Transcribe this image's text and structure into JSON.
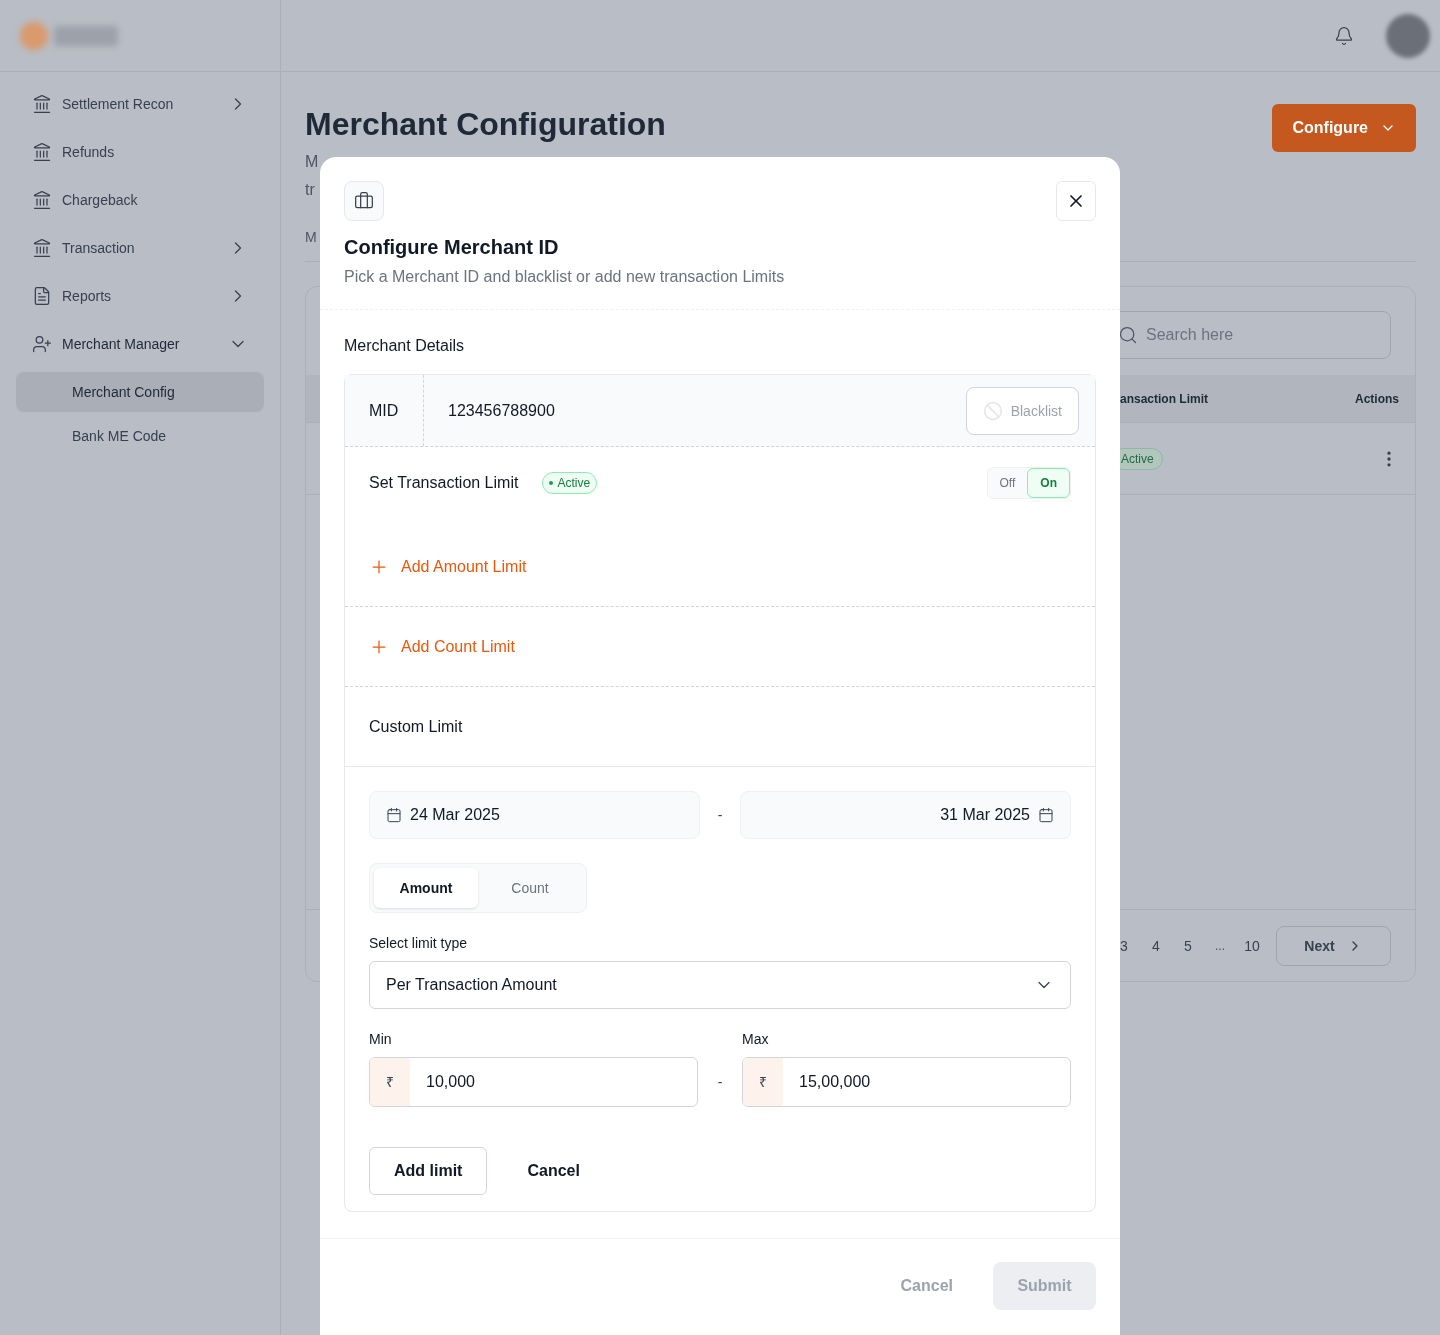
{
  "sidebar": {
    "items": [
      {
        "label": "Settlement Recon",
        "selected": false,
        "expanded": false
      },
      {
        "label": "Refunds",
        "selected": false
      },
      {
        "label": "Chargeback",
        "selected": false
      },
      {
        "label": "Transaction",
        "selected": false,
        "expanded": false
      },
      {
        "label": "Reports",
        "selected": false,
        "expanded": false
      },
      {
        "label": "Merchant Manager",
        "selected": false,
        "expanded": true,
        "children": [
          {
            "label": "Merchant Config",
            "selected": true
          },
          {
            "label": "Bank ME Code",
            "selected": false
          }
        ]
      }
    ]
  },
  "page": {
    "title": "Merchant Configuration",
    "configure_button": "Configure",
    "subtitle_fragments": [
      "M",
      "tr"
    ],
    "tab_fragment": "M"
  },
  "table": {
    "search": {
      "placeholder": "Search here"
    },
    "columns": [
      "ansaction Limit",
      "Actions"
    ],
    "rows": [
      {
        "status": "Active"
      }
    ],
    "pagination": {
      "pages": [
        "3",
        "4",
        "5",
        "...",
        "10"
      ],
      "next": "Next"
    }
  },
  "modal": {
    "title": "Configure Merchant ID",
    "subtitle": "Pick a Merchant ID and blacklist or add new transaction Limits",
    "section": "Merchant Details",
    "mid": {
      "label": "MID",
      "value": "123456788900"
    },
    "blacklist_button": {
      "label": "Blacklist",
      "disabled": true
    },
    "transaction_limit": {
      "label": "Set Transaction Limit",
      "badge": "Active",
      "toggle": [
        {
          "label": "Off",
          "selected": false
        },
        {
          "label": "On",
          "selected": true
        }
      ]
    },
    "add_links": [
      "Add Amount Limit",
      "Add Count Limit"
    ],
    "custom_limit": {
      "title": "Custom Limit",
      "start_date": "24 Mar 2025",
      "date_separator": "-",
      "end_date": "31 Mar 2025",
      "tabs": [
        {
          "label": "Amount",
          "selected": true
        },
        {
          "label": "Count",
          "selected": false
        }
      ],
      "limit_type": {
        "label": "Select limit type",
        "value": "Per Transaction Amount"
      },
      "min": {
        "label": "Min",
        "currency": "₹",
        "value": "10,000"
      },
      "range_separator": "-",
      "max": {
        "label": "Max",
        "currency": "₹",
        "value": "15,00,000"
      },
      "buttons": [
        "Add limit",
        "Cancel"
      ]
    },
    "footer": {
      "cancel": {
        "label": "Cancel",
        "disabled": true
      },
      "submit": {
        "label": "Submit",
        "disabled": true
      }
    }
  }
}
